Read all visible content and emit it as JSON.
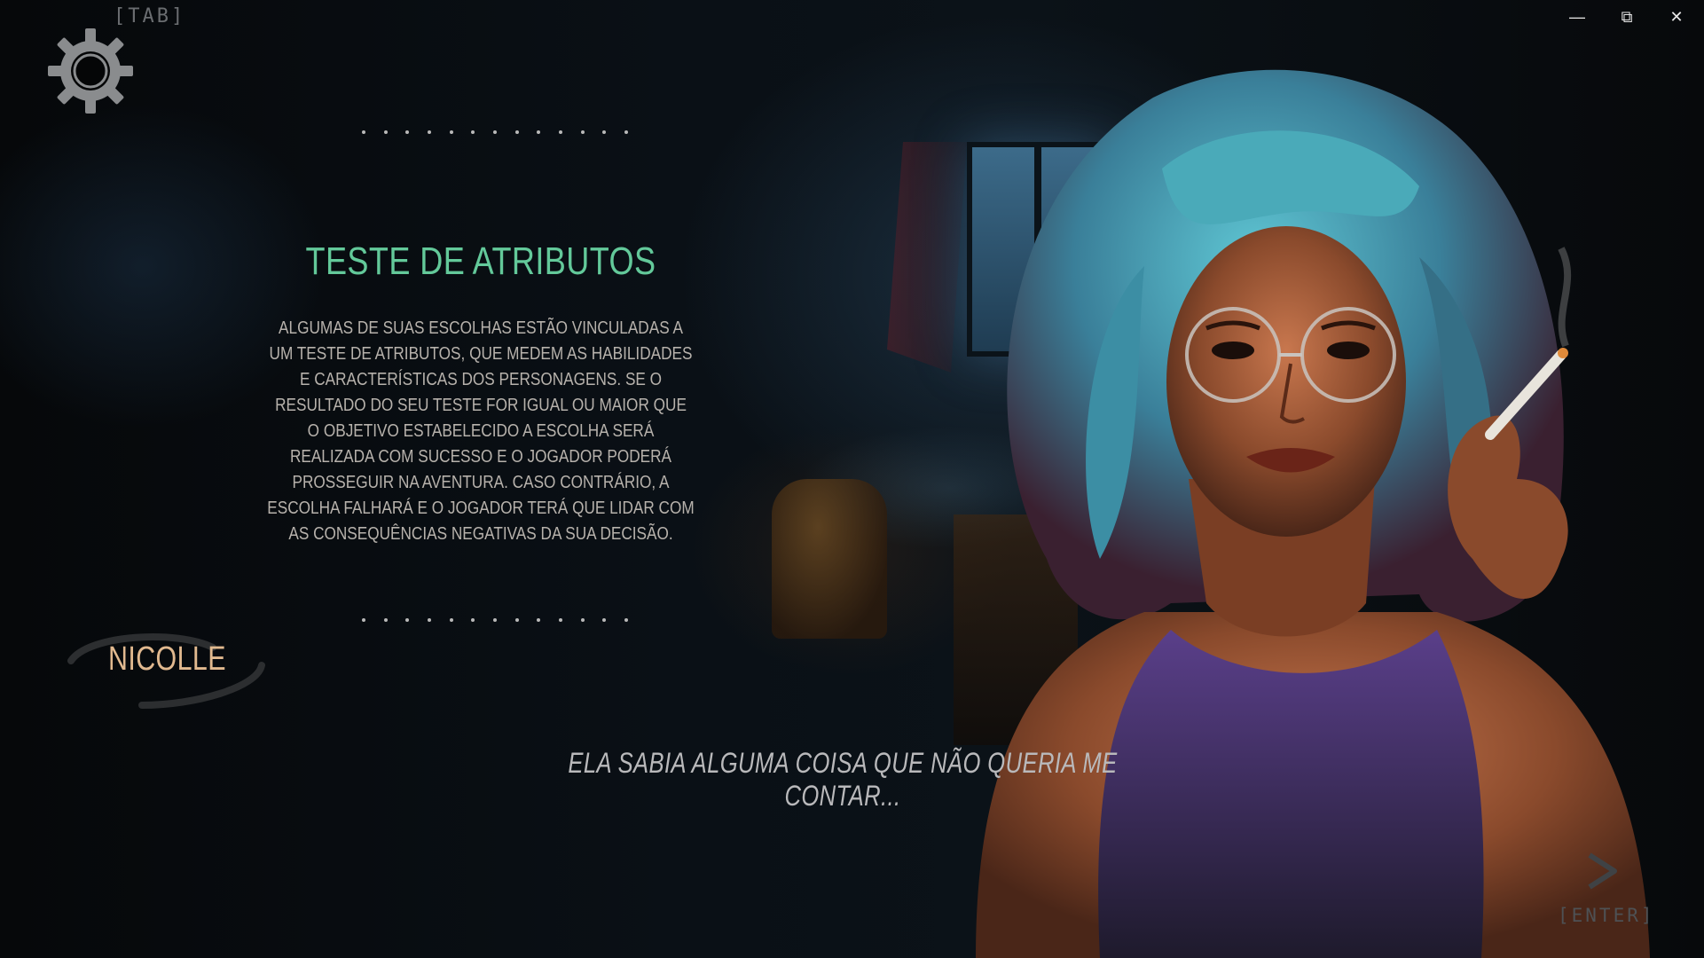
{
  "hints": {
    "tab": "[TAB]",
    "enter": "[ENTER]"
  },
  "icons": {
    "settings": "gear-icon",
    "next": "chevron-right-icon",
    "minimize": "minimize-icon",
    "restore": "restore-icon",
    "close": "close-icon"
  },
  "window_controls": {
    "minimize": "—",
    "restore": "⧉",
    "close": "✕"
  },
  "panel": {
    "title": "TESTE DE ATRIBUTOS",
    "body": "ALGUMAS DE SUAS ESCOLHAS ESTÃO VINCULADAS A UM TESTE DE ATRIBUTOS, QUE MEDEM AS HABILIDADES E CARACTERÍSTICAS DOS PERSONAGENS. SE O RESULTADO DO SEU TESTE FOR IGUAL OU MAIOR QUE O OBJETIVO ESTABELECIDO A ESCOLHA SERÁ REALIZADA COM SUCESSO E O JOGADOR PODERÁ PROSSEGUIR NA AVENTURA. CASO CONTRÁRIO, A ESCOLHA FALHARÁ E O JOGADOR TERÁ QUE LIDAR COM AS CONSEQUÊNCIAS NEGATIVAS DA SUA DECISÃO."
  },
  "speaker": {
    "name": "NICOLLE"
  },
  "dialogue": {
    "text": "ELA SABIA ALGUMA COISA QUE NÃO QUERIA ME CONTAR..."
  },
  "colors": {
    "title": "#63c99a",
    "speaker": "#e1b98f",
    "hair": "#3aa7b8",
    "top": "#3b2f5c"
  }
}
